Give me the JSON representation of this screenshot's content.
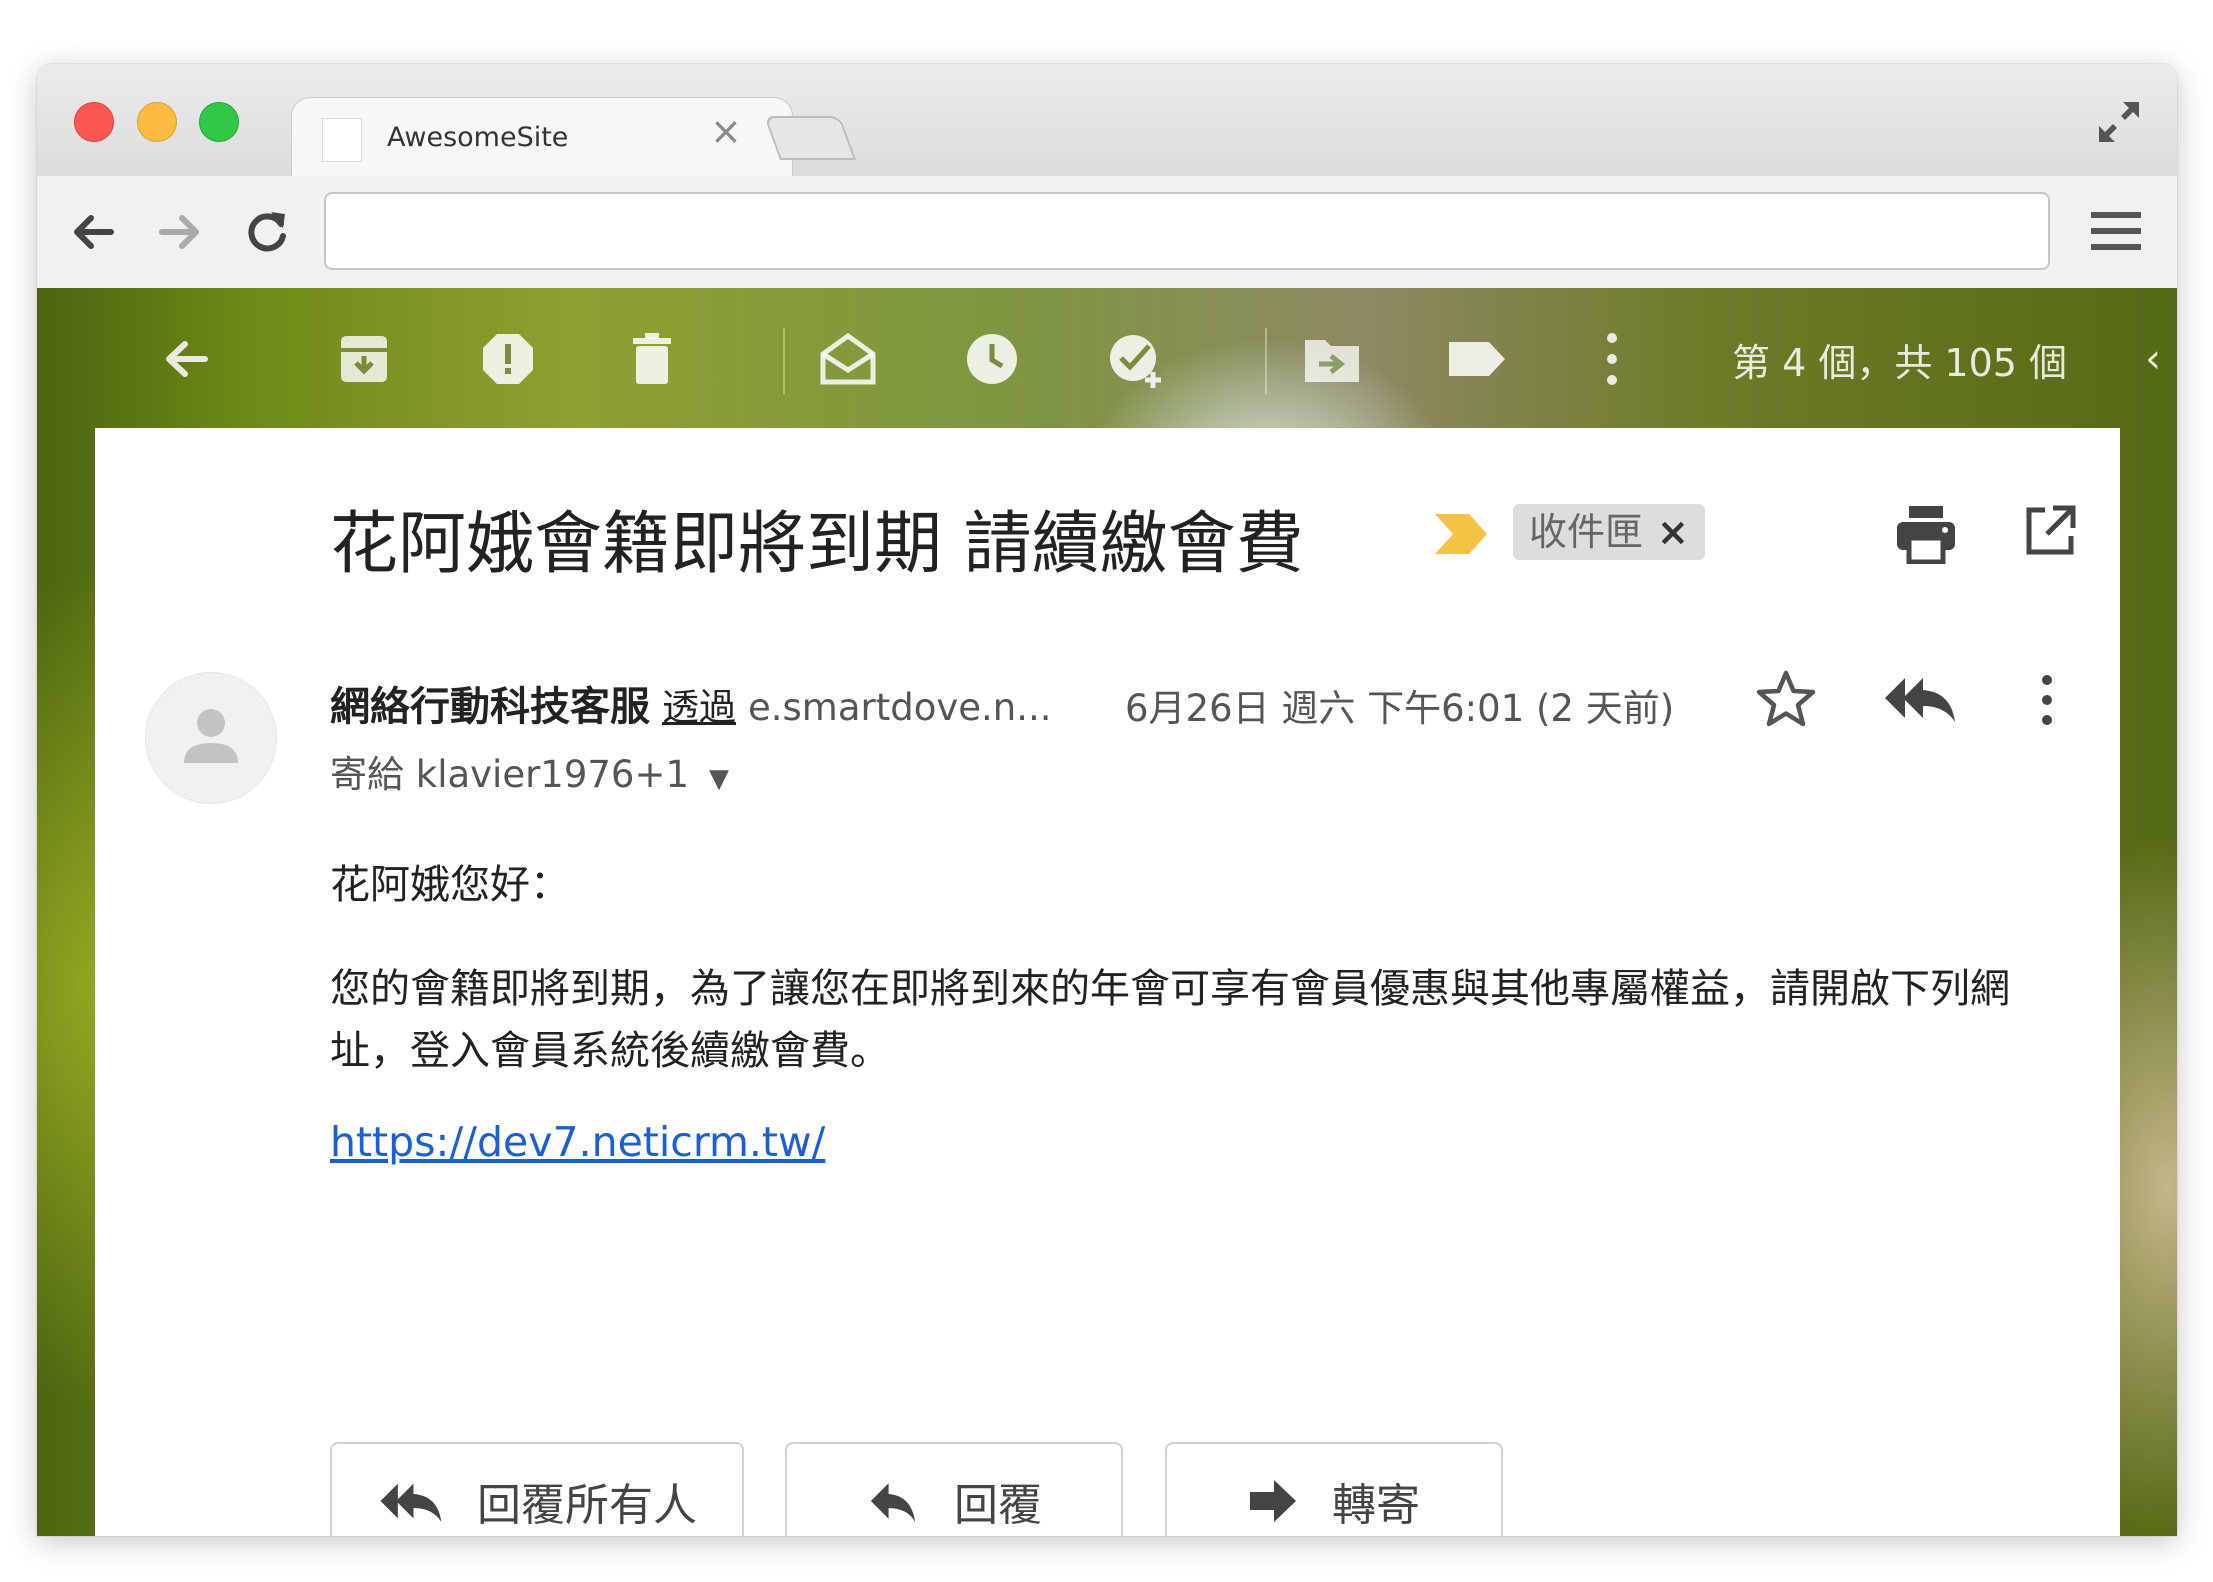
{
  "browser": {
    "tab_title": "AwesomeSite",
    "tab_close": "×",
    "address_value": ""
  },
  "gmail_toolbar": {
    "icons": [
      "back-arrow-icon",
      "archive-icon",
      "report-spam-icon",
      "delete-icon",
      "mark-unread-icon",
      "snooze-icon",
      "add-to-tasks-icon",
      "move-to-icon",
      "labels-icon",
      "more-vert-icon"
    ],
    "pager": "第 4 個，共 105 個",
    "pager_chevron": "‹"
  },
  "email": {
    "subject": "花阿娥會籍即將到期 請續繳會費",
    "label_chip": "收件匣",
    "label_chip_remove": "×",
    "sender_name": "網絡行動科技客服",
    "via": "透過",
    "sender_domain": "e.smartdove.n...",
    "date": "6月26日 週六 下午6:01 (2 天前)",
    "recipient": "寄給 klavier1976+1",
    "greeting": "花阿娥您好：",
    "body": "您的會籍即將到期，為了讓您在即將到來的年會可享有會員優惠與其他專屬權益，請開啟下列網址，登入會員系統後續繳會費。",
    "link": "https://dev7.neticrm.tw/"
  },
  "actions": {
    "reply_all": "回覆所有人",
    "reply": "回覆",
    "forward": "轉寄"
  },
  "colors": {
    "link": "#1a5fd6",
    "important_marker": "#f5c343",
    "traffic_red": "#fc5753",
    "traffic_yellow": "#fdbc40",
    "traffic_green": "#33c748"
  }
}
